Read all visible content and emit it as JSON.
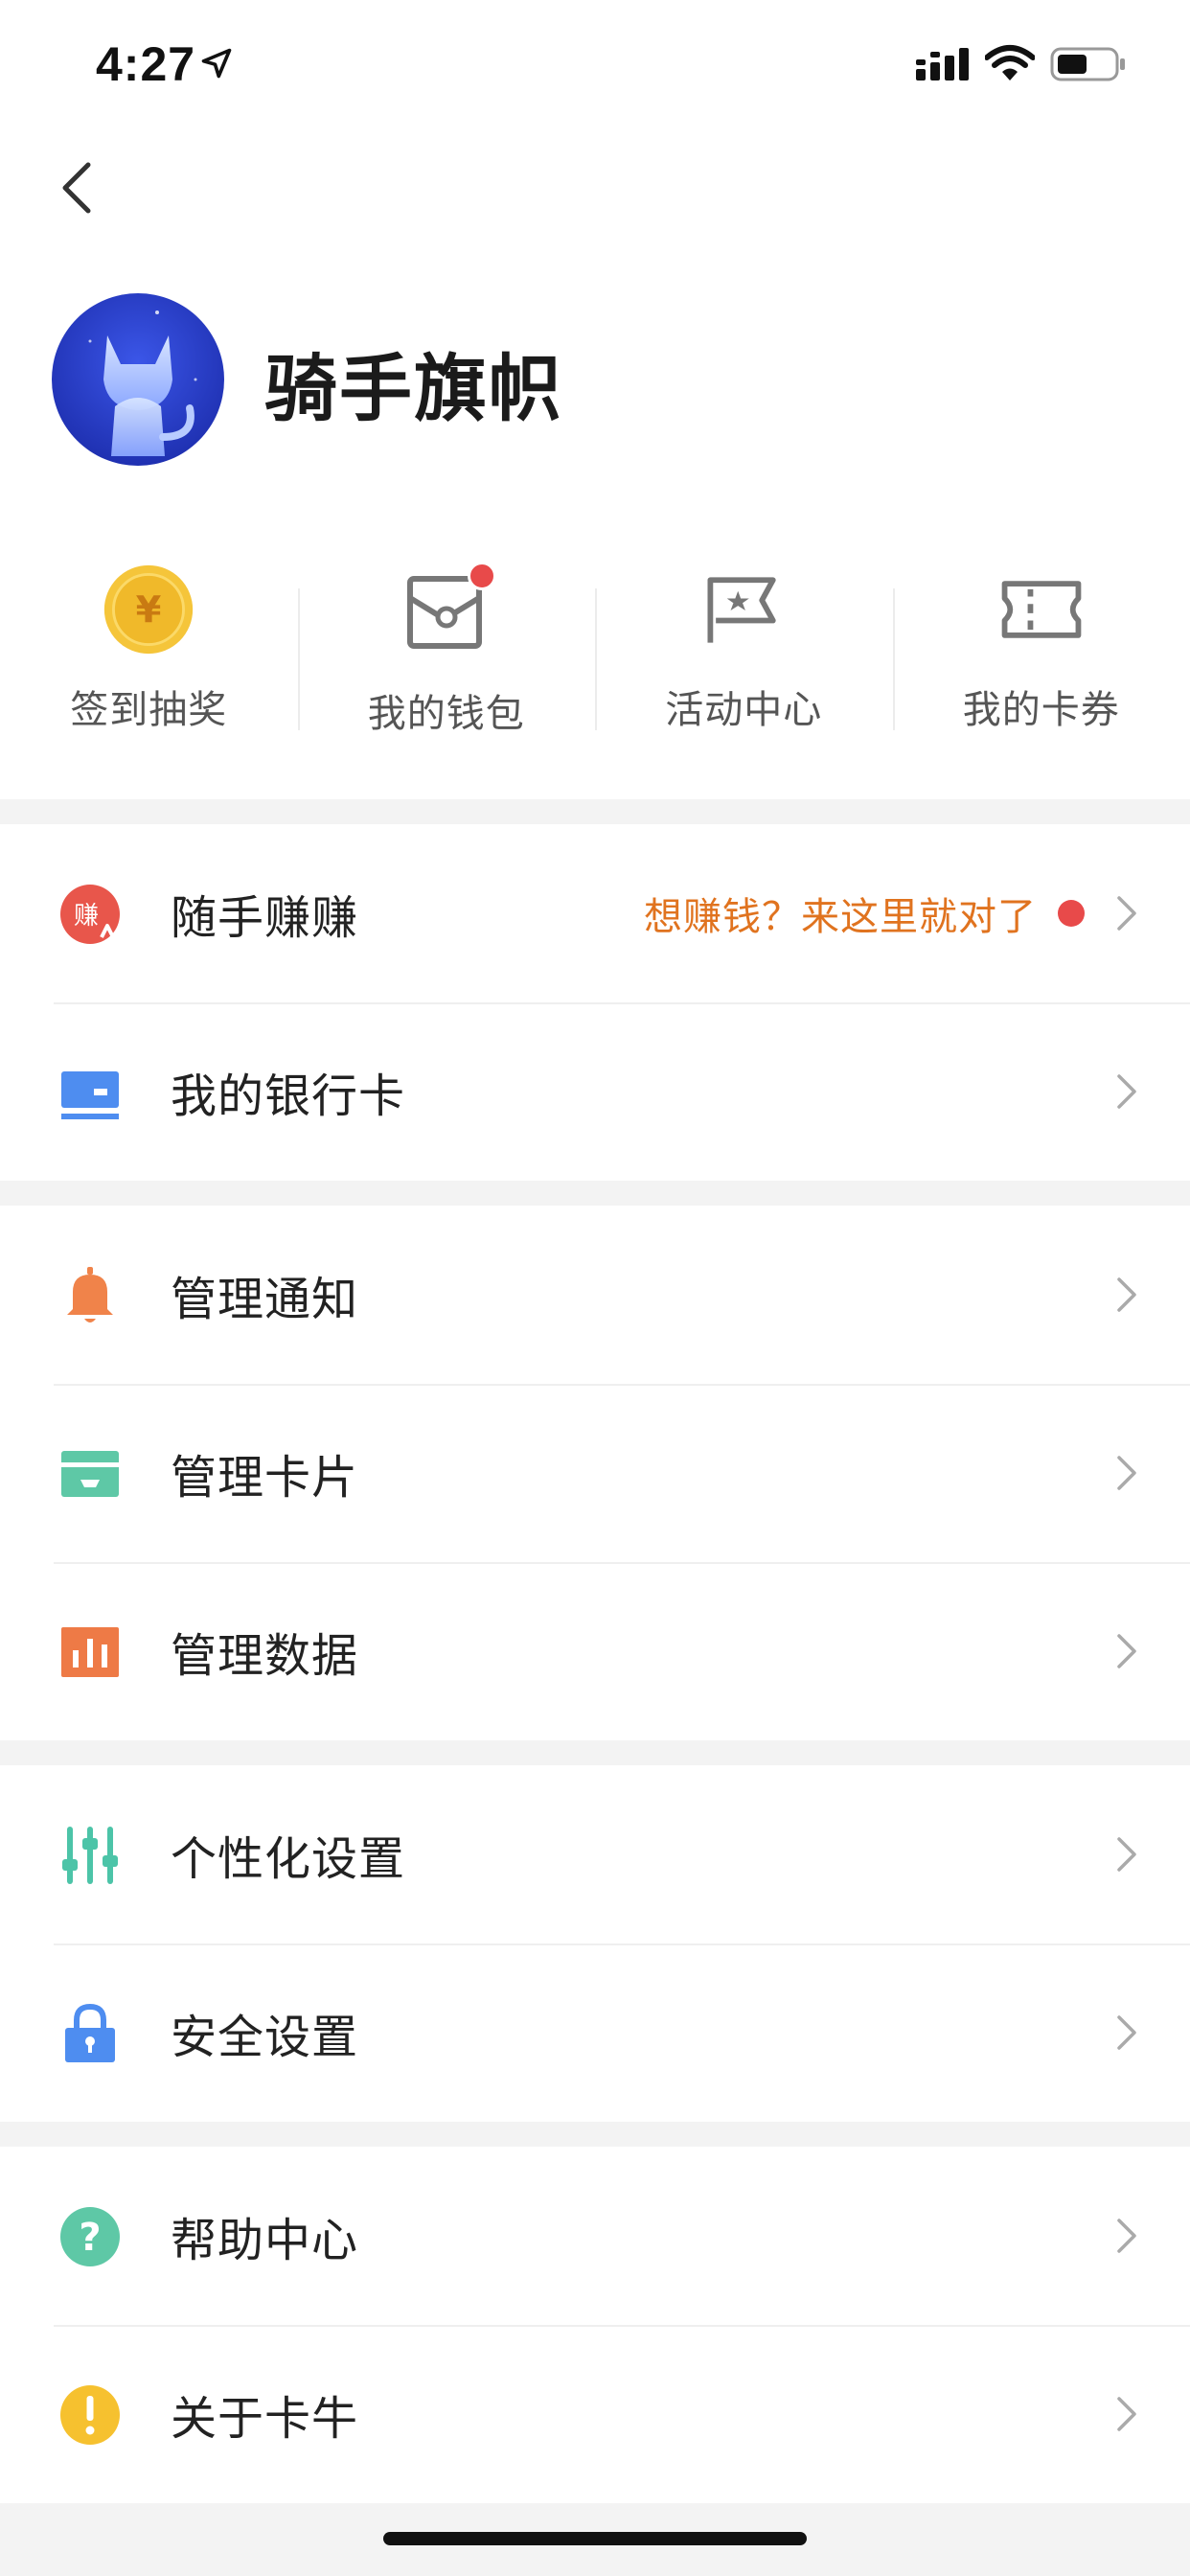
{
  "status_bar": {
    "time": "4:27",
    "icons": [
      "location-arrow-icon",
      "signal-icon",
      "wifi-icon",
      "battery-icon"
    ]
  },
  "nav": {
    "back_icon": "chevron-left-icon"
  },
  "profile": {
    "name": "骑手旗帜",
    "avatar_icon": "cat-avatar"
  },
  "quick_actions": [
    {
      "label": "签到抽奖",
      "icon": "gold-coin-icon"
    },
    {
      "label": "我的钱包",
      "icon": "wallet-envelope-icon",
      "badge": true
    },
    {
      "label": "活动中心",
      "icon": "star-flag-icon"
    },
    {
      "label": "我的卡券",
      "icon": "ticket-icon"
    }
  ],
  "sections": [
    {
      "rows": [
        {
          "label": "随手赚赚",
          "icon": "earn-icon",
          "promo": "想赚钱？来这里就对了",
          "badge": true
        },
        {
          "label": "我的银行卡",
          "icon": "bank-card-icon"
        }
      ]
    },
    {
      "rows": [
        {
          "label": "管理通知",
          "icon": "bell-icon"
        },
        {
          "label": "管理卡片",
          "icon": "card-icon"
        },
        {
          "label": "管理数据",
          "icon": "bar-chart-icon"
        }
      ]
    },
    {
      "rows": [
        {
          "label": "个性化设置",
          "icon": "sliders-icon"
        },
        {
          "label": "安全设置",
          "icon": "lock-icon"
        }
      ]
    },
    {
      "rows": [
        {
          "label": "帮助中心",
          "icon": "question-icon"
        },
        {
          "label": "关于卡牛",
          "icon": "exclamation-icon"
        }
      ]
    }
  ],
  "colors": {
    "promo_text": "#e0731f",
    "badge_red": "#e84a4a",
    "separator": "#f3f3f3",
    "earn": "#e8564b",
    "bank_card": "#4e8df0",
    "bell": "#f0834a",
    "card": "#5ec8a6",
    "bar_chart": "#ee7a46",
    "sliders": "#4cc4a8",
    "lock": "#4e8df0",
    "question": "#5ec8a6",
    "exclamation": "#f6c12f"
  }
}
